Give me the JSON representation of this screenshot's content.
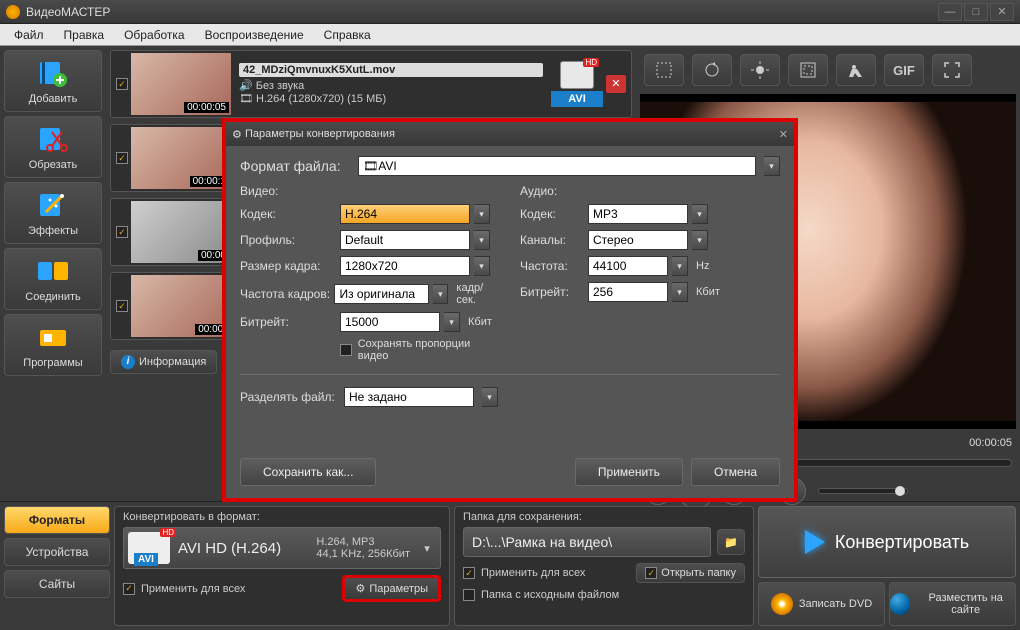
{
  "titlebar": {
    "title": "ВидеоМАСТЕР"
  },
  "menu": {
    "file": "Файл",
    "edit": "Правка",
    "process": "Обработка",
    "playback": "Воспроизведение",
    "help": "Справка"
  },
  "sidebar": {
    "add": "Добавить",
    "cut": "Обрезать",
    "effects": "Эффекты",
    "join": "Соединить",
    "programs": "Программы"
  },
  "clips": [
    {
      "name": "42_MDziQmvnuxK5XutL.mov",
      "audio": "Без звука",
      "codec": "H.264 (1280x720) (15 МБ)",
      "time": "00:00:05",
      "fmt": "AVI"
    },
    {
      "name": "",
      "audio": "",
      "codec": "",
      "time": "00:00:1",
      "fmt": ""
    },
    {
      "name": "",
      "audio": "",
      "codec": "",
      "time": "00:00",
      "fmt": ""
    },
    {
      "name": "",
      "audio": "",
      "codec": "",
      "time": "00:00:",
      "fmt": ""
    }
  ],
  "info_button": "Информация",
  "preview": {
    "time": "00:00:05"
  },
  "toolbar_icons": {
    "crop": "crop",
    "rotate": "rotate",
    "brightness": "brightness",
    "frame": "frame",
    "speed": "speed",
    "gif": "GIF",
    "fullscreen": "fullscreen"
  },
  "bottom": {
    "tabs": {
      "formats": "Форматы",
      "devices": "Устройства",
      "sites": "Сайты"
    },
    "convert": {
      "header": "Конвертировать в формат:",
      "format_name": "AVI HD (H.264)",
      "sub1": "H.264, MP3",
      "sub2": "44,1 KHz, 256Кбит",
      "avitag": "AVI",
      "apply_all": "Применить для всех",
      "params": "Параметры"
    },
    "save": {
      "header": "Папка для сохранения:",
      "path": "D:\\...\\Рамка на видео\\",
      "apply_all": "Применить для всех",
      "src_folder": "Папка с исходным файлом",
      "open_folder": "Открыть папку"
    },
    "actions": {
      "convert": "Конвертировать",
      "dvd": "Записать DVD",
      "publish": "Разместить на сайте"
    }
  },
  "modal": {
    "title": "Параметры конвертирования",
    "file_format_label": "Формат файла:",
    "file_format_value": "AVI",
    "video_section": "Видео:",
    "audio_section": "Аудио:",
    "video": {
      "codec_label": "Кодек:",
      "codec": "H.264",
      "profile_label": "Профиль:",
      "profile": "Default",
      "framesize_label": "Размер кадра:",
      "framesize": "1280x720",
      "framerate_label": "Частота кадров:",
      "framerate": "Из оригинала",
      "framerate_unit": "кадр/сек.",
      "bitrate_label": "Битрейт:",
      "bitrate": "15000",
      "bitrate_unit": "Кбит",
      "keep_aspect": "Сохранять пропорции видео"
    },
    "audio": {
      "codec_label": "Кодек:",
      "codec": "MP3",
      "channels_label": "Каналы:",
      "channels": "Стерео",
      "freq_label": "Частота:",
      "freq": "44100",
      "freq_unit": "Hz",
      "bitrate_label": "Битрейт:",
      "bitrate": "256",
      "bitrate_unit": "Кбит"
    },
    "split_label": "Разделять файл:",
    "split_value": "Не задано",
    "save_as": "Сохранить как...",
    "apply": "Применить",
    "cancel": "Отмена"
  }
}
